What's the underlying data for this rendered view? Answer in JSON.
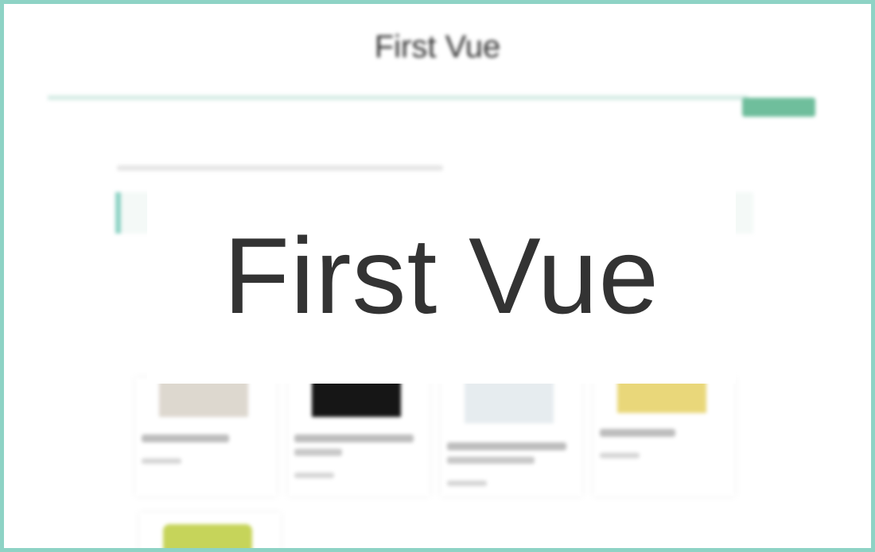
{
  "app": {
    "title": "First Vue"
  },
  "header": {
    "title": "First Vue"
  },
  "colors": {
    "accent": "#8ed3c5",
    "button": "#6fbe9c",
    "text": "#333333"
  }
}
